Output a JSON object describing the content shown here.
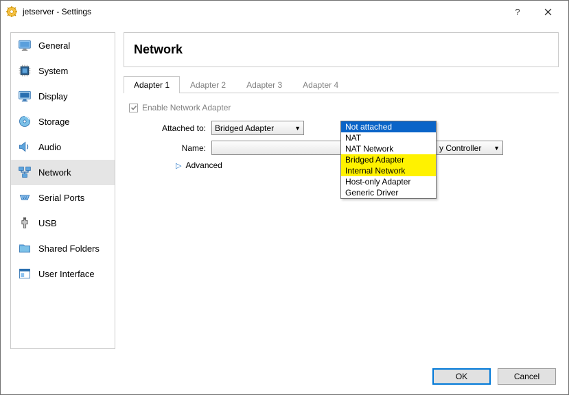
{
  "window": {
    "title": "jetserver - Settings"
  },
  "sidebar": {
    "items": [
      {
        "label": "General"
      },
      {
        "label": "System"
      },
      {
        "label": "Display"
      },
      {
        "label": "Storage"
      },
      {
        "label": "Audio"
      },
      {
        "label": "Network"
      },
      {
        "label": "Serial Ports"
      },
      {
        "label": "USB"
      },
      {
        "label": "Shared Folders"
      },
      {
        "label": "User Interface"
      }
    ],
    "selected_index": 5
  },
  "panel": {
    "title": "Network"
  },
  "tabs": {
    "items": [
      {
        "label": "Adapter 1"
      },
      {
        "label": "Adapter 2"
      },
      {
        "label": "Adapter 3"
      },
      {
        "label": "Adapter 4"
      }
    ],
    "active_index": 0
  },
  "adapter": {
    "enable_label": "Enable Network Adapter",
    "attached_label": "Attached to:",
    "attached_value": "Bridged Adapter",
    "name_label": "Name:",
    "name_value_suffix": "y Controller",
    "advanced_label": "Advanced"
  },
  "dropdown": {
    "items": [
      "Not attached",
      "NAT",
      "NAT Network",
      "Bridged Adapter",
      "Internal Network",
      "Host-only Adapter",
      "Generic Driver"
    ],
    "selected_index": 0,
    "highlight_indices": [
      3,
      4
    ]
  },
  "buttons": {
    "ok": "OK",
    "cancel": "Cancel"
  }
}
